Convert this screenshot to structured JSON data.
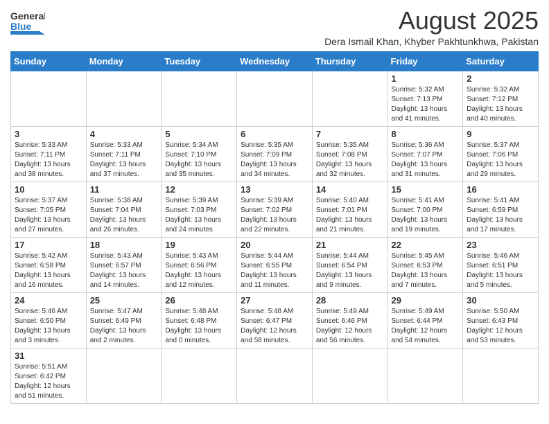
{
  "header": {
    "logo_general": "General",
    "logo_blue": "Blue",
    "month_title": "August 2025",
    "subtitle": "Dera Ismail Khan, Khyber Pakhtunkhwa, Pakistan"
  },
  "weekdays": [
    "Sunday",
    "Monday",
    "Tuesday",
    "Wednesday",
    "Thursday",
    "Friday",
    "Saturday"
  ],
  "weeks": [
    [
      {
        "day": "",
        "info": ""
      },
      {
        "day": "",
        "info": ""
      },
      {
        "day": "",
        "info": ""
      },
      {
        "day": "",
        "info": ""
      },
      {
        "day": "",
        "info": ""
      },
      {
        "day": "1",
        "info": "Sunrise: 5:32 AM\nSunset: 7:13 PM\nDaylight: 13 hours\nand 41 minutes."
      },
      {
        "day": "2",
        "info": "Sunrise: 5:32 AM\nSunset: 7:12 PM\nDaylight: 13 hours\nand 40 minutes."
      }
    ],
    [
      {
        "day": "3",
        "info": "Sunrise: 5:33 AM\nSunset: 7:11 PM\nDaylight: 13 hours\nand 38 minutes."
      },
      {
        "day": "4",
        "info": "Sunrise: 5:33 AM\nSunset: 7:11 PM\nDaylight: 13 hours\nand 37 minutes."
      },
      {
        "day": "5",
        "info": "Sunrise: 5:34 AM\nSunset: 7:10 PM\nDaylight: 13 hours\nand 35 minutes."
      },
      {
        "day": "6",
        "info": "Sunrise: 5:35 AM\nSunset: 7:09 PM\nDaylight: 13 hours\nand 34 minutes."
      },
      {
        "day": "7",
        "info": "Sunrise: 5:35 AM\nSunset: 7:08 PM\nDaylight: 13 hours\nand 32 minutes."
      },
      {
        "day": "8",
        "info": "Sunrise: 5:36 AM\nSunset: 7:07 PM\nDaylight: 13 hours\nand 31 minutes."
      },
      {
        "day": "9",
        "info": "Sunrise: 5:37 AM\nSunset: 7:06 PM\nDaylight: 13 hours\nand 29 minutes."
      }
    ],
    [
      {
        "day": "10",
        "info": "Sunrise: 5:37 AM\nSunset: 7:05 PM\nDaylight: 13 hours\nand 27 minutes."
      },
      {
        "day": "11",
        "info": "Sunrise: 5:38 AM\nSunset: 7:04 PM\nDaylight: 13 hours\nand 26 minutes."
      },
      {
        "day": "12",
        "info": "Sunrise: 5:39 AM\nSunset: 7:03 PM\nDaylight: 13 hours\nand 24 minutes."
      },
      {
        "day": "13",
        "info": "Sunrise: 5:39 AM\nSunset: 7:02 PM\nDaylight: 13 hours\nand 22 minutes."
      },
      {
        "day": "14",
        "info": "Sunrise: 5:40 AM\nSunset: 7:01 PM\nDaylight: 13 hours\nand 21 minutes."
      },
      {
        "day": "15",
        "info": "Sunrise: 5:41 AM\nSunset: 7:00 PM\nDaylight: 13 hours\nand 19 minutes."
      },
      {
        "day": "16",
        "info": "Sunrise: 5:41 AM\nSunset: 6:59 PM\nDaylight: 13 hours\nand 17 minutes."
      }
    ],
    [
      {
        "day": "17",
        "info": "Sunrise: 5:42 AM\nSunset: 6:58 PM\nDaylight: 13 hours\nand 16 minutes."
      },
      {
        "day": "18",
        "info": "Sunrise: 5:43 AM\nSunset: 6:57 PM\nDaylight: 13 hours\nand 14 minutes."
      },
      {
        "day": "19",
        "info": "Sunrise: 5:43 AM\nSunset: 6:56 PM\nDaylight: 13 hours\nand 12 minutes."
      },
      {
        "day": "20",
        "info": "Sunrise: 5:44 AM\nSunset: 6:55 PM\nDaylight: 13 hours\nand 11 minutes."
      },
      {
        "day": "21",
        "info": "Sunrise: 5:44 AM\nSunset: 6:54 PM\nDaylight: 13 hours\nand 9 minutes."
      },
      {
        "day": "22",
        "info": "Sunrise: 5:45 AM\nSunset: 6:53 PM\nDaylight: 13 hours\nand 7 minutes."
      },
      {
        "day": "23",
        "info": "Sunrise: 5:46 AM\nSunset: 6:51 PM\nDaylight: 13 hours\nand 5 minutes."
      }
    ],
    [
      {
        "day": "24",
        "info": "Sunrise: 5:46 AM\nSunset: 6:50 PM\nDaylight: 13 hours\nand 3 minutes."
      },
      {
        "day": "25",
        "info": "Sunrise: 5:47 AM\nSunset: 6:49 PM\nDaylight: 13 hours\nand 2 minutes."
      },
      {
        "day": "26",
        "info": "Sunrise: 5:48 AM\nSunset: 6:48 PM\nDaylight: 13 hours\nand 0 minutes."
      },
      {
        "day": "27",
        "info": "Sunrise: 5:48 AM\nSunset: 6:47 PM\nDaylight: 12 hours\nand 58 minutes."
      },
      {
        "day": "28",
        "info": "Sunrise: 5:49 AM\nSunset: 6:46 PM\nDaylight: 12 hours\nand 56 minutes."
      },
      {
        "day": "29",
        "info": "Sunrise: 5:49 AM\nSunset: 6:44 PM\nDaylight: 12 hours\nand 54 minutes."
      },
      {
        "day": "30",
        "info": "Sunrise: 5:50 AM\nSunset: 6:43 PM\nDaylight: 12 hours\nand 53 minutes."
      }
    ],
    [
      {
        "day": "31",
        "info": "Sunrise: 5:51 AM\nSunset: 6:42 PM\nDaylight: 12 hours\nand 51 minutes."
      },
      {
        "day": "",
        "info": ""
      },
      {
        "day": "",
        "info": ""
      },
      {
        "day": "",
        "info": ""
      },
      {
        "day": "",
        "info": ""
      },
      {
        "day": "",
        "info": ""
      },
      {
        "day": "",
        "info": ""
      }
    ]
  ]
}
